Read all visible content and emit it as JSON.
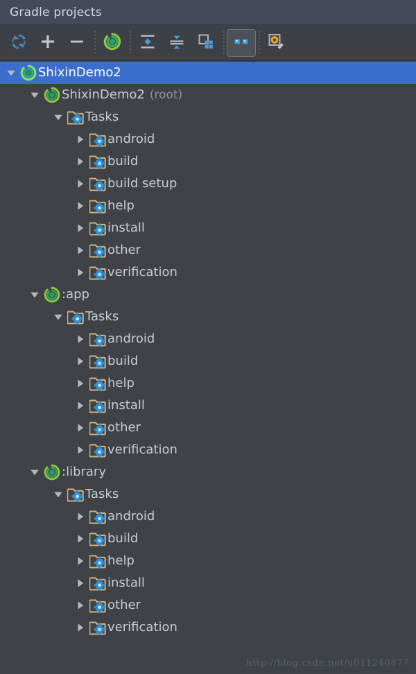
{
  "header": {
    "title": "Gradle projects"
  },
  "toolbar": {
    "buttons": [
      {
        "name": "refresh-icon",
        "tooltip": "Refresh all Gradle projects",
        "active": false
      },
      {
        "name": "plus-icon",
        "tooltip": "Add",
        "active": false
      },
      {
        "name": "minus-icon",
        "tooltip": "Remove",
        "active": false
      },
      {
        "name": "execute-task-icon",
        "tooltip": "Execute Gradle Task",
        "active": false
      },
      {
        "name": "expand-all-icon",
        "tooltip": "Expand All",
        "active": false
      },
      {
        "name": "collapse-all-icon",
        "tooltip": "Collapse All",
        "active": false
      },
      {
        "name": "group-modules-icon",
        "tooltip": "Group Modules",
        "active": false
      },
      {
        "name": "toggle-offline-icon",
        "tooltip": "Toggle Offline Mode",
        "active": true
      },
      {
        "name": "gradle-settings-icon",
        "tooltip": "Gradle Settings",
        "active": false
      }
    ],
    "separators_after": [
      2,
      3,
      6,
      7
    ]
  },
  "tree": {
    "rows": [
      {
        "level": 0,
        "twisty": "down",
        "icon": "gradle-icon",
        "label": "ShixinDemo2",
        "sub": "",
        "selected": true
      },
      {
        "level": 1,
        "twisty": "down",
        "icon": "gradle-icon",
        "label": "ShixinDemo2",
        "sub": "(root)",
        "selected": false
      },
      {
        "level": 2,
        "twisty": "down",
        "icon": "tasks-folder-icon",
        "label": "Tasks",
        "sub": "",
        "selected": false
      },
      {
        "level": 3,
        "twisty": "right",
        "icon": "tasks-folder-icon",
        "label": "android",
        "sub": "",
        "selected": false
      },
      {
        "level": 3,
        "twisty": "right",
        "icon": "tasks-folder-icon",
        "label": "build",
        "sub": "",
        "selected": false
      },
      {
        "level": 3,
        "twisty": "right",
        "icon": "tasks-folder-icon",
        "label": "build setup",
        "sub": "",
        "selected": false
      },
      {
        "level": 3,
        "twisty": "right",
        "icon": "tasks-folder-icon",
        "label": "help",
        "sub": "",
        "selected": false
      },
      {
        "level": 3,
        "twisty": "right",
        "icon": "tasks-folder-icon",
        "label": "install",
        "sub": "",
        "selected": false
      },
      {
        "level": 3,
        "twisty": "right",
        "icon": "tasks-folder-icon",
        "label": "other",
        "sub": "",
        "selected": false
      },
      {
        "level": 3,
        "twisty": "right",
        "icon": "tasks-folder-icon",
        "label": "verification",
        "sub": "",
        "selected": false
      },
      {
        "level": 1,
        "twisty": "down",
        "icon": "gradle-icon",
        "label": ":app",
        "sub": "",
        "selected": false
      },
      {
        "level": 2,
        "twisty": "down",
        "icon": "tasks-folder-icon",
        "label": "Tasks",
        "sub": "",
        "selected": false
      },
      {
        "level": 3,
        "twisty": "right",
        "icon": "tasks-folder-icon",
        "label": "android",
        "sub": "",
        "selected": false
      },
      {
        "level": 3,
        "twisty": "right",
        "icon": "tasks-folder-icon",
        "label": "build",
        "sub": "",
        "selected": false
      },
      {
        "level": 3,
        "twisty": "right",
        "icon": "tasks-folder-icon",
        "label": "help",
        "sub": "",
        "selected": false
      },
      {
        "level": 3,
        "twisty": "right",
        "icon": "tasks-folder-icon",
        "label": "install",
        "sub": "",
        "selected": false
      },
      {
        "level": 3,
        "twisty": "right",
        "icon": "tasks-folder-icon",
        "label": "other",
        "sub": "",
        "selected": false
      },
      {
        "level": 3,
        "twisty": "right",
        "icon": "tasks-folder-icon",
        "label": "verification",
        "sub": "",
        "selected": false
      },
      {
        "level": 1,
        "twisty": "down",
        "icon": "gradle-icon",
        "label": ":library",
        "sub": "",
        "selected": false
      },
      {
        "level": 2,
        "twisty": "down",
        "icon": "tasks-folder-icon",
        "label": "Tasks",
        "sub": "",
        "selected": false
      },
      {
        "level": 3,
        "twisty": "right",
        "icon": "tasks-folder-icon",
        "label": "android",
        "sub": "",
        "selected": false
      },
      {
        "level": 3,
        "twisty": "right",
        "icon": "tasks-folder-icon",
        "label": "build",
        "sub": "",
        "selected": false
      },
      {
        "level": 3,
        "twisty": "right",
        "icon": "tasks-folder-icon",
        "label": "help",
        "sub": "",
        "selected": false
      },
      {
        "level": 3,
        "twisty": "right",
        "icon": "tasks-folder-icon",
        "label": "install",
        "sub": "",
        "selected": false
      },
      {
        "level": 3,
        "twisty": "right",
        "icon": "tasks-folder-icon",
        "label": "other",
        "sub": "",
        "selected": false
      },
      {
        "level": 3,
        "twisty": "right",
        "icon": "tasks-folder-icon",
        "label": "verification",
        "sub": "",
        "selected": false
      }
    ]
  },
  "watermark": {
    "text": "http://blog.csdn.net/u011240877"
  },
  "colors": {
    "header_bg": "#45495c",
    "toolbar_bg": "#3d4045",
    "tree_bg": "#3f4247",
    "selection_bg": "#3a6dcc",
    "text": "#c9ccd1",
    "muted_text": "#8d9097",
    "folder": "#d9b277",
    "gear": "#3d97d4",
    "gradle_green": "#62b545"
  }
}
